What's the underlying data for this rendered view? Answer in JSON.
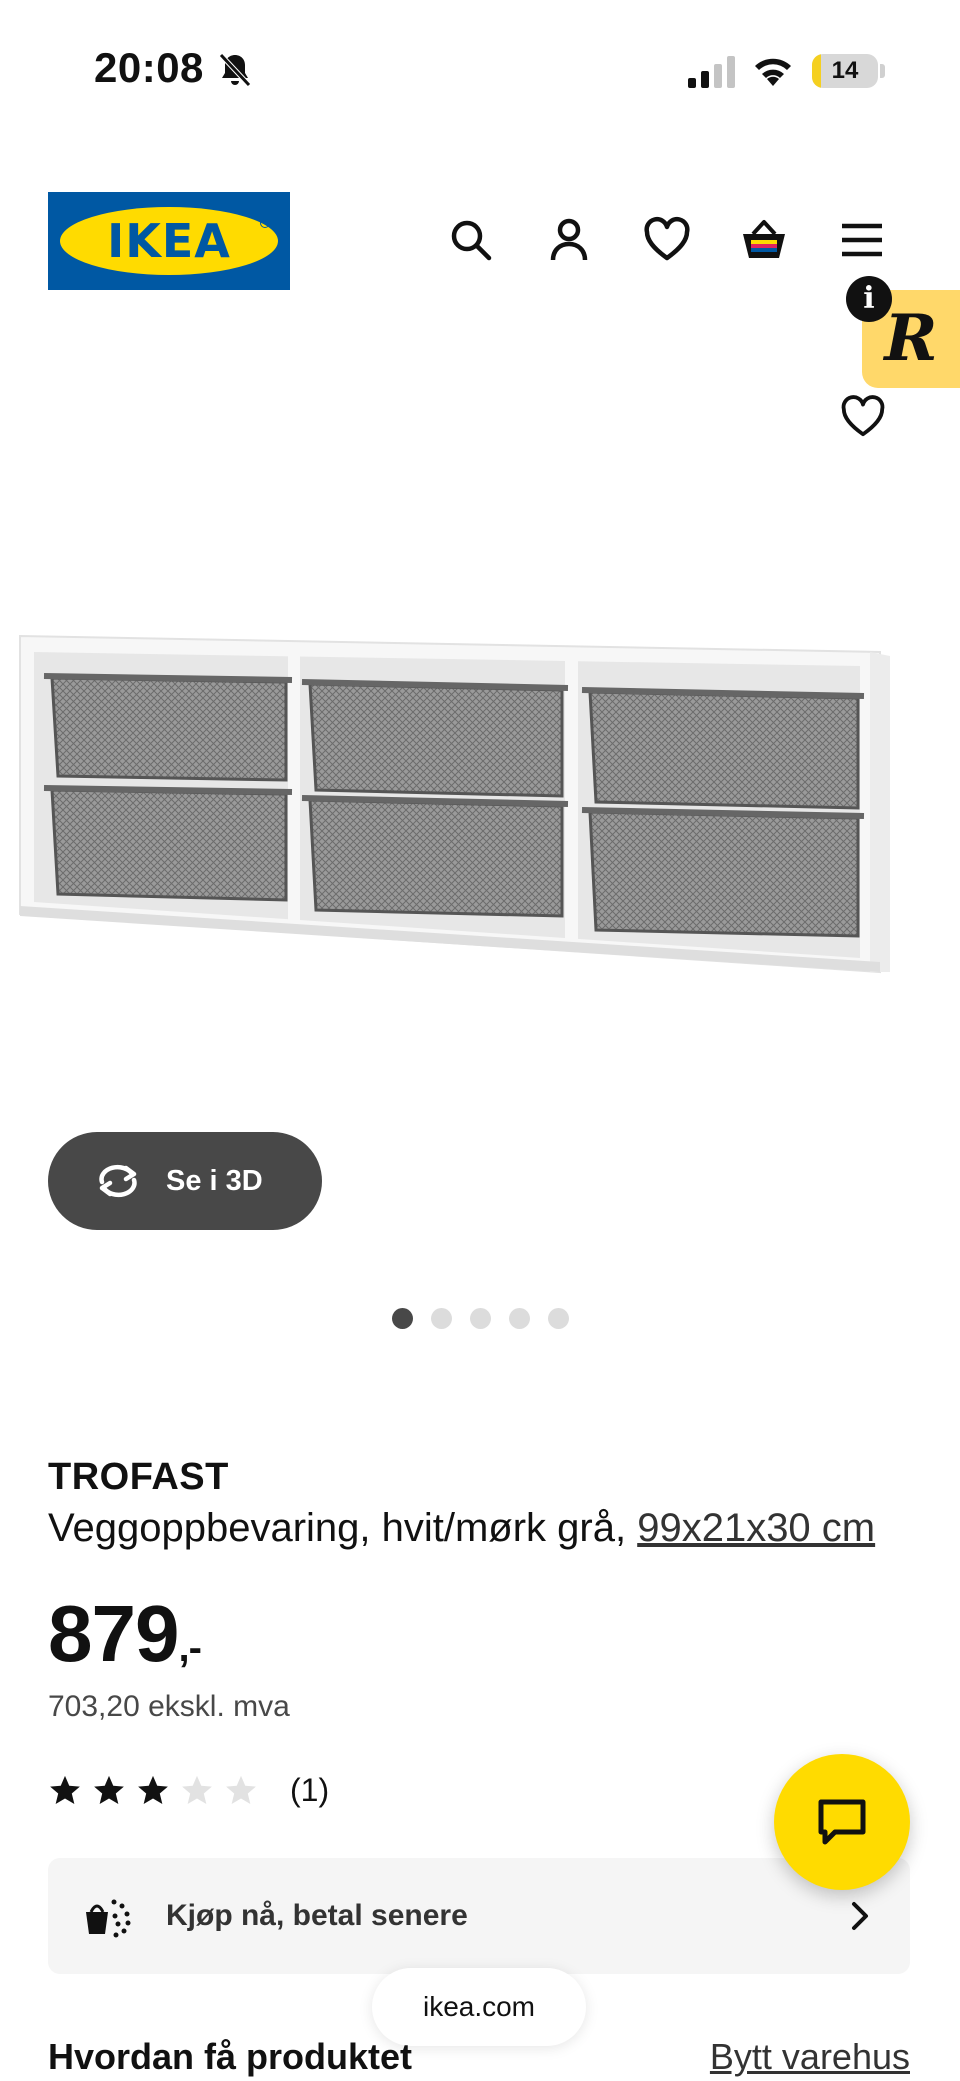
{
  "status_bar": {
    "time": "20:08",
    "battery": "14",
    "battery_level": 0.14,
    "icons": [
      "bell-slash-icon",
      "signal-icon",
      "wifi-icon",
      "battery-icon"
    ]
  },
  "header": {
    "logo_text": "IKEA",
    "icons": [
      "search-icon",
      "user-icon",
      "heart-icon",
      "basket-icon",
      "menu-icon"
    ]
  },
  "overlay": {
    "info_label": "i",
    "r_badge_label": "R"
  },
  "gallery": {
    "view_3d_label": "Se i 3D",
    "slide_count": 5,
    "active_slide": 1
  },
  "product": {
    "name": "TROFAST",
    "description": "Veggoppbevaring, hvit/mørk grå, ",
    "size": "99x21x30 cm",
    "price": "879",
    "price_suffix": ",-",
    "price_ex_vat": "703,20 ekskl. mva",
    "rating": 3,
    "rating_max": 5,
    "review_count": "(1)"
  },
  "pay_later": {
    "label": "Kjøp nå, betal senere"
  },
  "browser": {
    "url": "ikea.com"
  },
  "delivery": {
    "heading": "Hvordan få produktet",
    "change_store": "Bytt varehus"
  },
  "colors": {
    "ikea_blue": "#0058a3",
    "ikea_yellow": "#ffdb00",
    "dark_button": "#484848",
    "badge_yellow": "#ffd86a"
  }
}
